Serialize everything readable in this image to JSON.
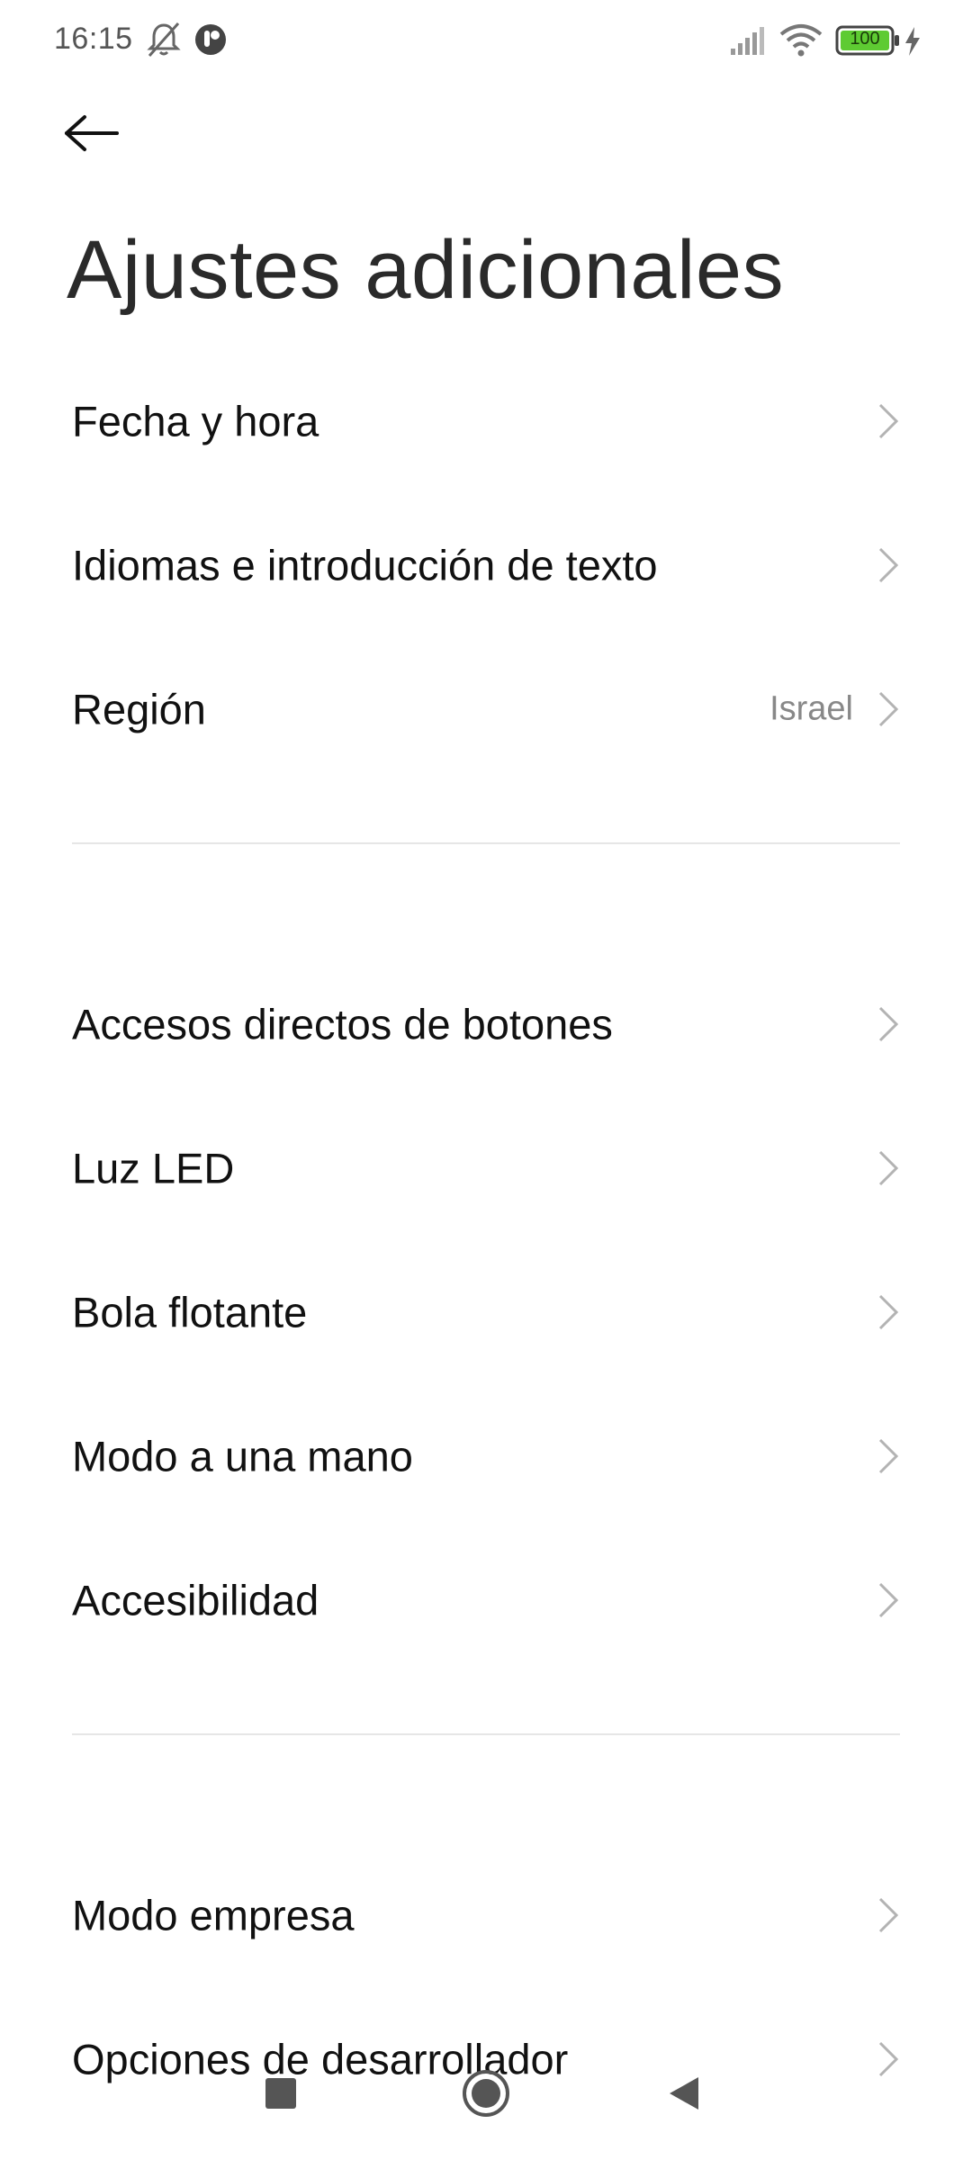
{
  "status_bar": {
    "time": "16:15",
    "battery_level": "100",
    "icons": [
      "bell-off-icon",
      "notification-app-icon",
      "signal-icon",
      "wifi-icon",
      "battery-icon",
      "charging-bolt-icon"
    ],
    "battery_color": "#5ecb32"
  },
  "header": {
    "back_icon": "arrow-left-icon",
    "title": "Ajustes adicionales"
  },
  "sections": [
    {
      "items": [
        {
          "label": "Fecha y hora",
          "value": ""
        },
        {
          "label": "Idiomas e introducción de texto",
          "value": ""
        },
        {
          "label": "Región",
          "value": "Israel"
        }
      ]
    },
    {
      "items": [
        {
          "label": "Accesos directos de botones",
          "value": ""
        },
        {
          "label": "Luz LED",
          "value": ""
        },
        {
          "label": "Bola flotante",
          "value": ""
        },
        {
          "label": "Modo a una mano",
          "value": ""
        },
        {
          "label": "Accesibilidad",
          "value": ""
        }
      ]
    },
    {
      "items": [
        {
          "label": "Modo empresa",
          "value": ""
        },
        {
          "label": "Opciones de desarrollador",
          "value": ""
        }
      ]
    }
  ],
  "nav_bar": {
    "icons": [
      "recents-square-icon",
      "home-circle-icon",
      "back-triangle-icon"
    ]
  }
}
